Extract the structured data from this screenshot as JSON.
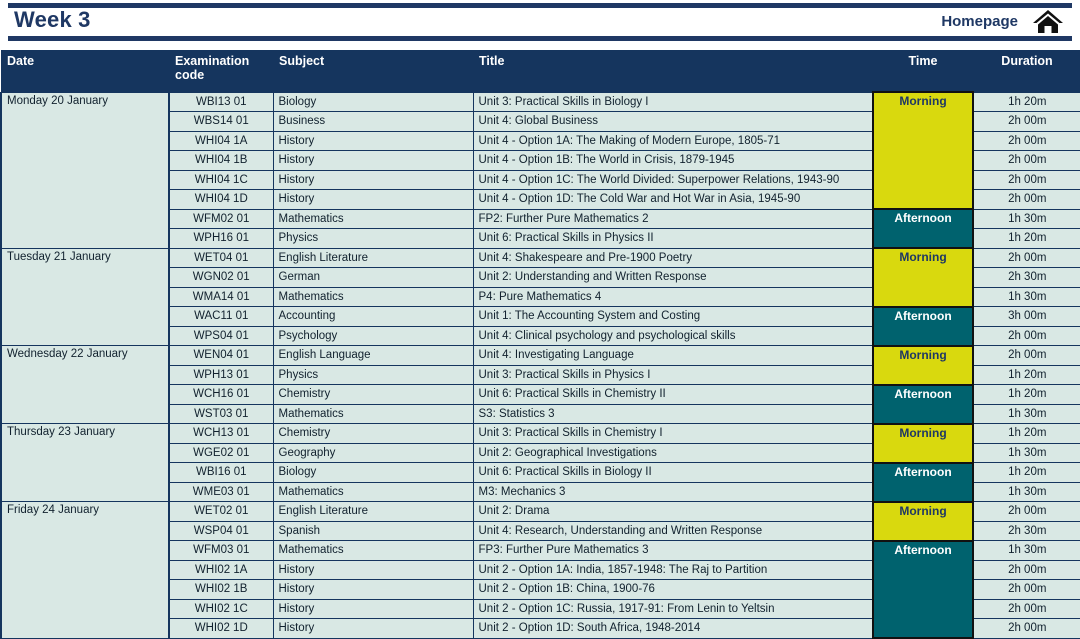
{
  "header": {
    "title": "Week 3",
    "homepage_label": "Homepage",
    "home_icon": "home-icon",
    "accent_color": "#1F3864"
  },
  "table": {
    "columns": [
      "Date",
      "Examination code",
      "Subject",
      "Title",
      "Time",
      "Duration"
    ],
    "header_bg": "#15355E",
    "cell_bg": "#D9E8E4",
    "morning_color": "#D9D90E",
    "afternoon_color": "#00626E",
    "days": [
      {
        "date": "Monday 20 January",
        "sessions": [
          {
            "time": "Morning",
            "exams": [
              {
                "code": "WBI13 01",
                "subject": "Biology",
                "title": "Unit 3: Practical Skills in Biology I",
                "duration": "1h 20m"
              },
              {
                "code": "WBS14 01",
                "subject": "Business",
                "title": "Unit 4: Global Business",
                "duration": "2h 00m"
              },
              {
                "code": "WHI04 1A",
                "subject": "History",
                "title": "Unit 4 - Option 1A: The Making of Modern Europe, 1805-71",
                "duration": "2h 00m"
              },
              {
                "code": "WHI04 1B",
                "subject": "History",
                "title": "Unit 4 - Option 1B: The World in Crisis, 1879-1945",
                "duration": "2h 00m"
              },
              {
                "code": "WHI04 1C",
                "subject": "History",
                "title": "Unit 4 - Option 1C: The World Divided: Superpower Relations, 1943-90",
                "duration": "2h 00m"
              },
              {
                "code": "WHI04 1D",
                "subject": "History",
                "title": "Unit 4 - Option 1D: The Cold War and Hot War in Asia, 1945-90",
                "duration": "2h 00m"
              }
            ]
          },
          {
            "time": "Afternoon",
            "exams": [
              {
                "code": "WFM02 01",
                "subject": "Mathematics",
                "title": "FP2: Further Pure Mathematics 2",
                "duration": "1h 30m"
              },
              {
                "code": "WPH16 01",
                "subject": "Physics",
                "title": "Unit 6: Practical Skills in Physics II",
                "duration": "1h 20m"
              }
            ]
          }
        ]
      },
      {
        "date": "Tuesday 21 January",
        "sessions": [
          {
            "time": "Morning",
            "exams": [
              {
                "code": "WET04 01",
                "subject": "English Literature",
                "title": "Unit 4: Shakespeare and Pre-1900 Poetry",
                "duration": "2h 00m"
              },
              {
                "code": "WGN02 01",
                "subject": "German",
                "title": "Unit 2: Understanding and Written Response",
                "duration": "2h 30m"
              },
              {
                "code": "WMA14 01",
                "subject": "Mathematics",
                "title": "P4: Pure Mathematics 4",
                "duration": "1h 30m"
              }
            ]
          },
          {
            "time": "Afternoon",
            "exams": [
              {
                "code": "WAC11 01",
                "subject": "Accounting",
                "title": "Unit 1: The Accounting System and Costing",
                "duration": "3h 00m"
              },
              {
                "code": "WPS04 01",
                "subject": "Psychology",
                "title": "Unit 4: Clinical psychology and psychological skills",
                "duration": "2h 00m"
              }
            ]
          }
        ]
      },
      {
        "date": "Wednesday 22 January",
        "sessions": [
          {
            "time": "Morning",
            "exams": [
              {
                "code": "WEN04 01",
                "subject": "English Language",
                "title": "Unit 4: Investigating Language",
                "duration": "2h 00m"
              },
              {
                "code": "WPH13 01",
                "subject": "Physics",
                "title": "Unit 3: Practical Skills in Physics I",
                "duration": "1h 20m"
              }
            ]
          },
          {
            "time": "Afternoon",
            "exams": [
              {
                "code": "WCH16 01",
                "subject": "Chemistry",
                "title": "Unit 6: Practical Skills in Chemistry II",
                "duration": "1h 20m"
              },
              {
                "code": "WST03 01",
                "subject": "Mathematics",
                "title": "S3: Statistics 3",
                "duration": "1h 30m"
              }
            ]
          }
        ]
      },
      {
        "date": "Thursday 23 January",
        "sessions": [
          {
            "time": "Morning",
            "exams": [
              {
                "code": "WCH13 01",
                "subject": "Chemistry",
                "title": "Unit 3: Practical Skills in Chemistry I",
                "duration": "1h 20m"
              },
              {
                "code": "WGE02 01",
                "subject": "Geography",
                "title": "Unit 2: Geographical Investigations",
                "duration": "1h 30m"
              }
            ]
          },
          {
            "time": "Afternoon",
            "exams": [
              {
                "code": "WBI16 01",
                "subject": "Biology",
                "title": "Unit 6: Practical Skills in Biology II",
                "duration": "1h 20m"
              },
              {
                "code": "WME03 01",
                "subject": "Mathematics",
                "title": "M3: Mechanics 3",
                "duration": "1h 30m"
              }
            ]
          }
        ]
      },
      {
        "date": "Friday 24 January",
        "sessions": [
          {
            "time": "Morning",
            "exams": [
              {
                "code": "WET02 01",
                "subject": "English Literature",
                "title": "Unit 2: Drama",
                "duration": "2h 00m"
              },
              {
                "code": "WSP04 01",
                "subject": "Spanish",
                "title": "Unit 4: Research, Understanding and Written Response",
                "duration": "2h 30m"
              }
            ]
          },
          {
            "time": "Afternoon",
            "exams": [
              {
                "code": "WFM03 01",
                "subject": "Mathematics",
                "title": "FP3: Further Pure Mathematics 3",
                "duration": "1h 30m"
              },
              {
                "code": "WHI02 1A",
                "subject": "History",
                "title": "Unit 2 - Option 1A: India, 1857-1948: The Raj to Partition",
                "duration": "2h 00m"
              },
              {
                "code": "WHI02 1B",
                "subject": "History",
                "title": "Unit 2 - Option 1B: China, 1900-76",
                "duration": "2h 00m"
              },
              {
                "code": "WHI02 1C",
                "subject": "History",
                "title": "Unit 2 - Option 1C: Russia, 1917-91: From Lenin to Yeltsin",
                "duration": "2h 00m"
              },
              {
                "code": "WHI02 1D",
                "subject": "History",
                "title": "Unit 2 - Option 1D: South Africa, 1948-2014",
                "duration": "2h 00m"
              }
            ]
          }
        ]
      }
    ]
  }
}
